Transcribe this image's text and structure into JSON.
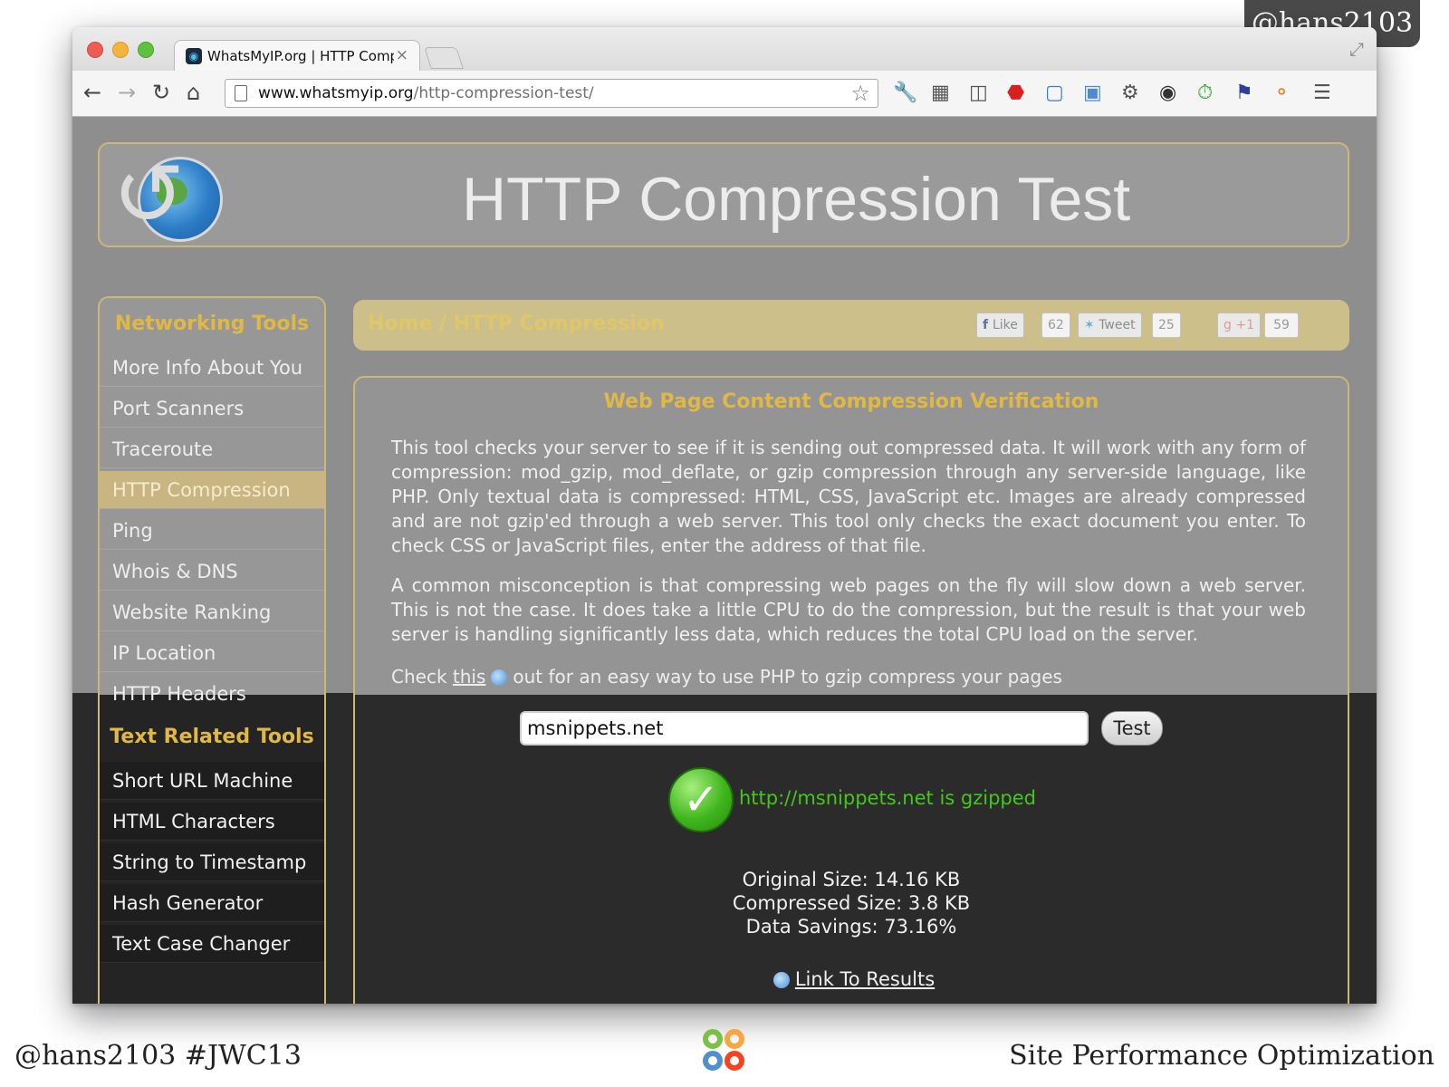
{
  "slide": {
    "corner_tag": "@hans2103",
    "footer_left": "@hans2103 #JWC13",
    "footer_right": "Site Performance Optimization",
    "center_logo_icon": "joomla-logo-icon"
  },
  "browser": {
    "tab_title": "WhatsMyIP.org | HTTP Comp",
    "url_host": "www.whatsmyip.org",
    "url_path": "/http-compression-test/",
    "extension_icons": [
      "wrench-icon",
      "qr-icon",
      "screen-capture-icon",
      "adblock-icon",
      "fullscreen-icon",
      "image-icon",
      "gear-icon",
      "color-wheel-icon",
      "timer-icon",
      "flag-icon",
      "rss-icon",
      "menu-icon"
    ]
  },
  "site": {
    "title": "HTTP Compression Test"
  },
  "sidebar": {
    "networking_heading": "Networking Tools",
    "networking_items": [
      {
        "label": "More Info About You"
      },
      {
        "label": "Port Scanners"
      },
      {
        "label": "Traceroute"
      },
      {
        "label": "HTTP Compression",
        "active": true
      },
      {
        "label": "Ping"
      },
      {
        "label": "Whois & DNS"
      },
      {
        "label": "Website Ranking"
      },
      {
        "label": "IP Location"
      },
      {
        "label": "HTTP Headers"
      }
    ],
    "text_heading": "Text Related Tools",
    "text_items": [
      {
        "label": "Short URL Machine"
      },
      {
        "label": "HTML Characters"
      },
      {
        "label": "String to Timestamp"
      },
      {
        "label": "Hash Generator"
      },
      {
        "label": "Text Case Changer"
      }
    ]
  },
  "breadcrumb": {
    "home": "Home",
    "separator": "/",
    "current": "HTTP Compression"
  },
  "social": {
    "like_label": "Like",
    "like_count": "62",
    "tweet_label": "Tweet",
    "tweet_count": "25",
    "plus_label": "+1",
    "plus_count": "59"
  },
  "content": {
    "heading": "Web Page Content Compression Verification",
    "paragraph1": "This tool checks your server to see if it is sending out compressed data. It will work with any form of compression: mod_gzip, mod_deflate, or gzip compression through any server-side language, like PHP. Only textual data is compressed: HTML, CSS, JavaScript etc. Images are already compressed and are not gzip'ed through a web server. This tool only checks the exact document you enter. To check CSS or JavaScript files, enter the address of that file.",
    "paragraph2": "A common misconception is that compressing web pages on the fly will slow down a web server. This is not the case. It does take a little CPU to do the compression, but the result is that your web server is handling significantly less data, which reduces the total CPU load on the server.",
    "check_prefix": "Check",
    "check_link": "this",
    "check_suffix": "out for an easy way to use PHP to gzip compress your pages"
  },
  "form": {
    "url_value": "msnippets.net",
    "test_label": "Test"
  },
  "result": {
    "message": "http://msnippets.net is gzipped",
    "original_size": "Original Size: 14.16 KB",
    "compressed_size": "Compressed Size: 3.8 KB",
    "data_savings": "Data Savings: 73.16%",
    "link_label": "Link To Results"
  },
  "colors": {
    "accent_gold": "#e0b845",
    "success_green": "#42c818",
    "dark_overlay": "#2a2a2a"
  }
}
